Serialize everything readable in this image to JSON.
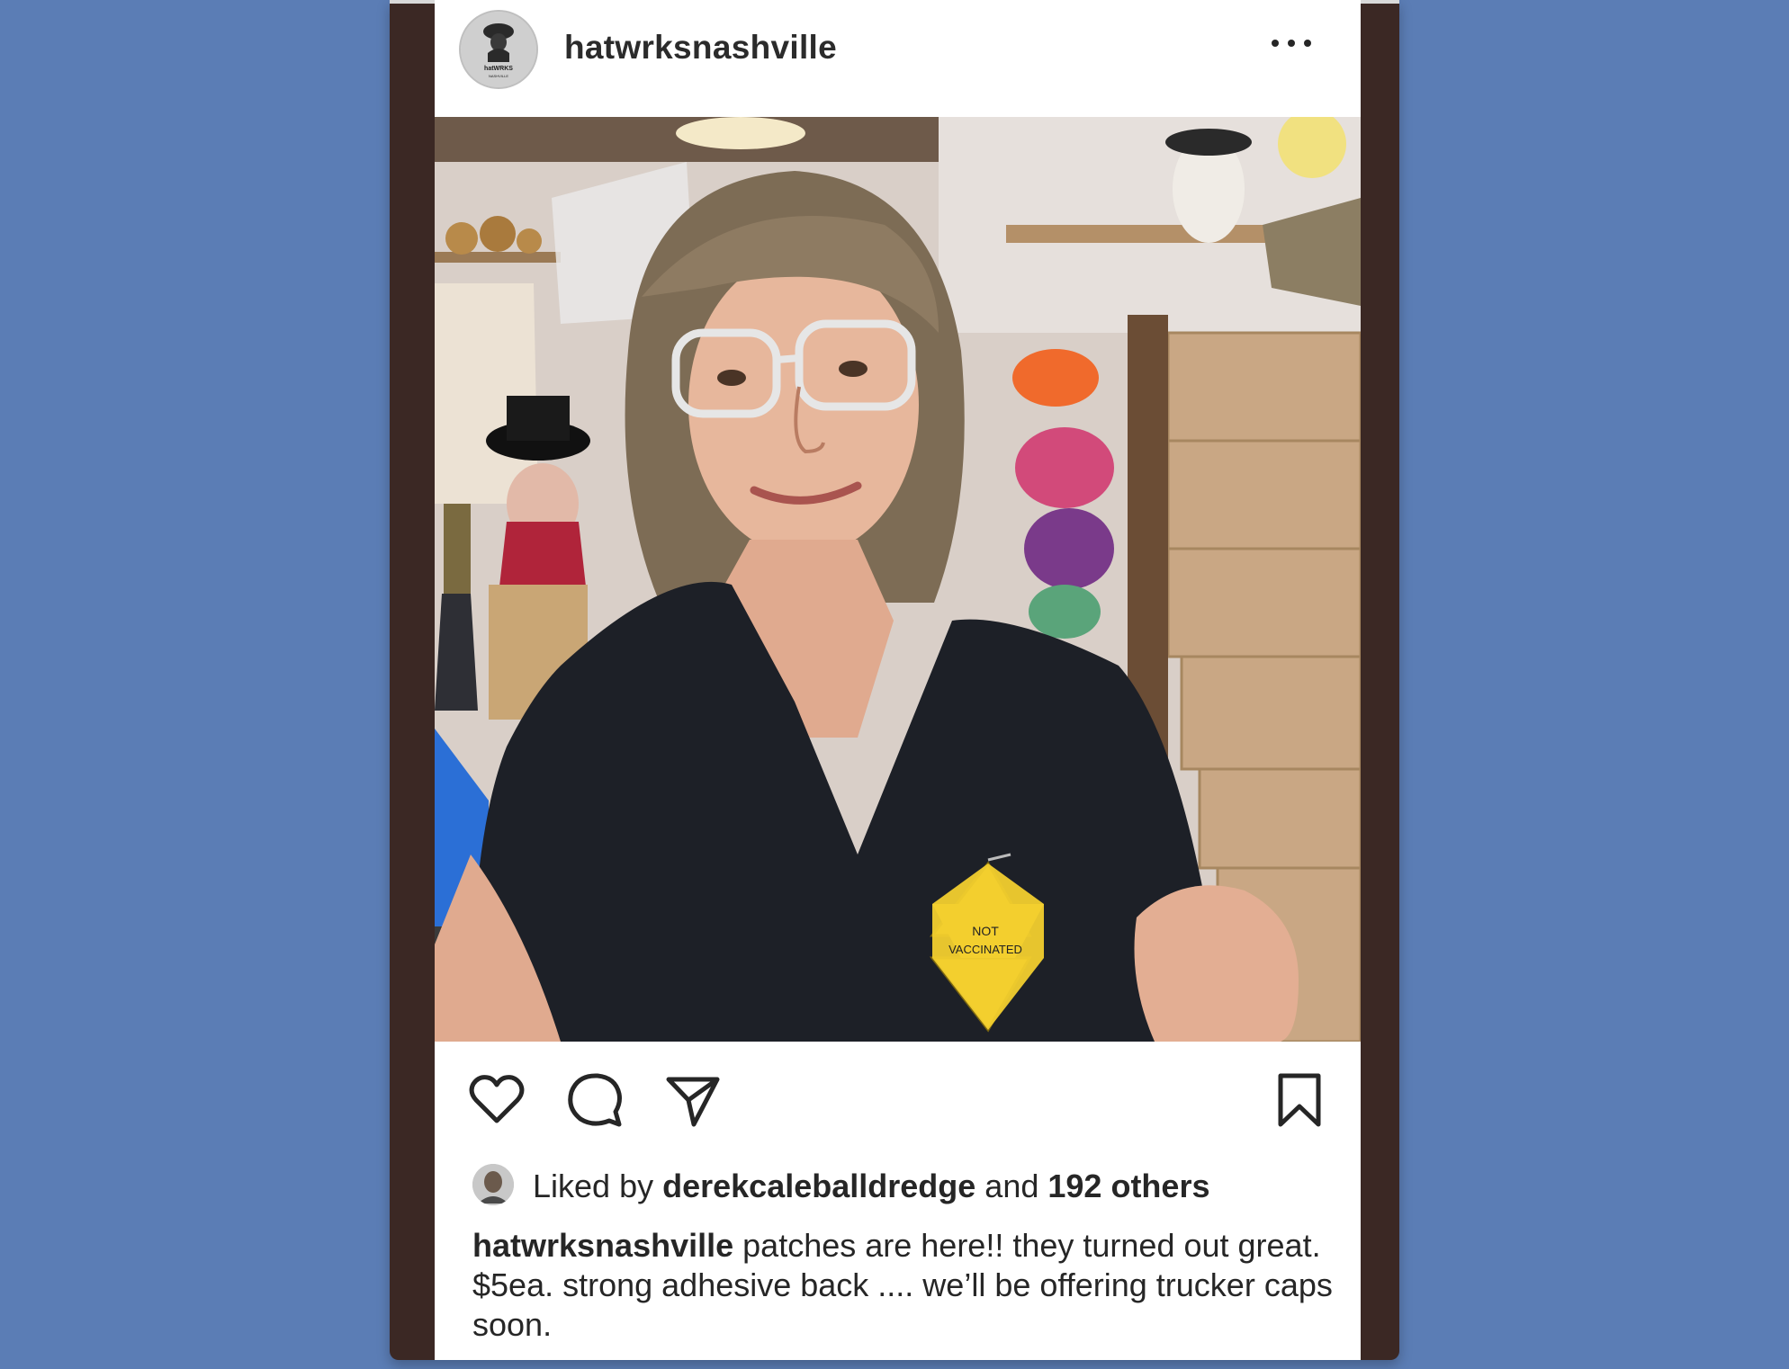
{
  "post": {
    "username": "hatwrksnashville",
    "avatar_icon": "hatwrks-logo-icon",
    "avatar_logo_text": "hatWRKS",
    "avatar_logo_sub": "NASHVILLE",
    "more_icon": "more-options-icon",
    "patch_line1": "NOT",
    "patch_line2": "VACCINATED",
    "actions": {
      "like_icon": "heart-icon",
      "comment_icon": "comment-icon",
      "share_icon": "paper-plane-icon",
      "save_icon": "bookmark-icon"
    },
    "likes": {
      "prefix": "Liked by",
      "user": "derekcaleballdredge",
      "middle": "and",
      "others": "192 others"
    },
    "caption": {
      "username": "hatwrksnashville",
      "text": "patches are here!! they turned out great. $5ea. strong adhesive back .... we’ll be offering trucker caps soon."
    }
  },
  "colors": {
    "background": "#5b7db5",
    "frame": "#3b2824",
    "card": "#ffffff",
    "text": "#262626",
    "patch": "#f2cf2e"
  }
}
